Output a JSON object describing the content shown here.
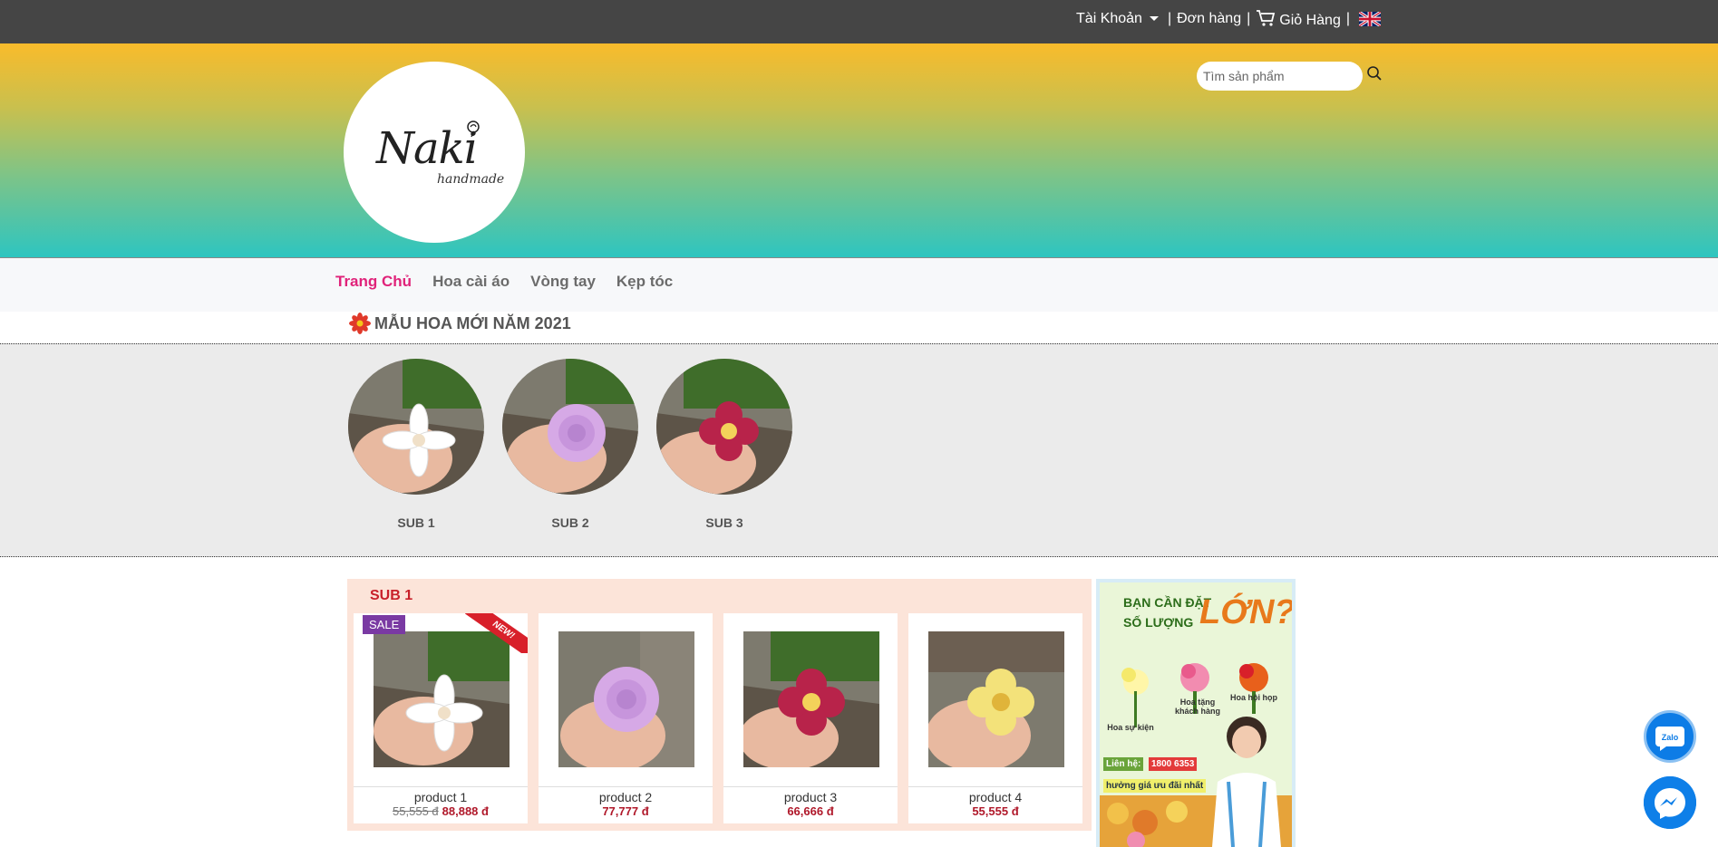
{
  "topbar": {
    "account": "Tài Khoản",
    "sep1": "|",
    "orders": "Đơn hàng",
    "sep2": "|",
    "cart": "Giỏ Hàng",
    "sep3": "|",
    "language_icon": "uk-flag-icon"
  },
  "header": {
    "logo_text": "Naki",
    "logo_sub": "handmade",
    "search_placeholder": "Tìm sản phẩm"
  },
  "nav": {
    "items": [
      {
        "label": "Trang Chủ",
        "active": true
      },
      {
        "label": "Hoa cài áo",
        "active": false
      },
      {
        "label": "Vòng tay",
        "active": false
      },
      {
        "label": "Kẹp tóc",
        "active": false
      }
    ]
  },
  "section": {
    "title": "MẪU HOA MỚI NĂM 2021"
  },
  "categories": [
    {
      "label": "SUB 1",
      "flower_color": "#ffffff"
    },
    {
      "label": "SUB 2",
      "flower_color": "#d6a9e6"
    },
    {
      "label": "SUB 3",
      "flower_color": "#b8234a"
    }
  ],
  "products_section": {
    "title": "SUB 1",
    "sale_badge": "SALE",
    "new_ribbon": "NEW!",
    "items": [
      {
        "name": "product 1",
        "old_price": "55,555 đ",
        "price": "88,888 đ",
        "flower_color": "#ffffff"
      },
      {
        "name": "product 2",
        "old_price": "",
        "price": "77,777 đ",
        "flower_color": "#d6a9e6"
      },
      {
        "name": "product 3",
        "old_price": "",
        "price": "66,666 đ",
        "flower_color": "#b8234a"
      },
      {
        "name": "product 4",
        "old_price": "",
        "price": "55,555 đ",
        "flower_color": "#f3e27a"
      }
    ]
  },
  "banner": {
    "line1": "BẠN CẦN ĐẶT",
    "line2": "SỐ LƯỢNG",
    "big": "LỚN?",
    "label_a": "Hoa tặng khách hàng",
    "label_b": "Hoa hội họp",
    "label_c": "Hoa sự kiện",
    "contact": "Liên hệ:",
    "phone": "1800 6353",
    "promo": "hưởng giá ưu đãi nhất"
  },
  "floating": {
    "zalo_label": "Zalo",
    "messenger_icon": "messenger-icon"
  },
  "colors": {
    "topbar": "#454545",
    "accent": "#e0237a",
    "price": "#b0182a",
    "sale": "#7a3aa3"
  }
}
